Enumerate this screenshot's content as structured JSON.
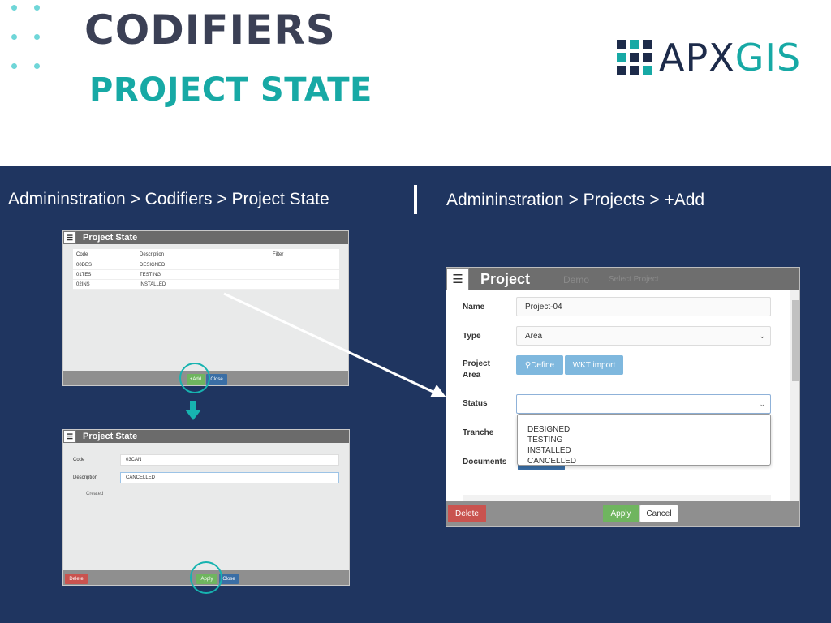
{
  "header": {
    "title": "CODIFIERS",
    "subtitle": "PROJECT STATE",
    "logo": {
      "part1": "APX",
      "part2": "GIS"
    },
    "logo_colors": [
      "#1d2b4a",
      "#17a9a5"
    ]
  },
  "breadcrumbs": {
    "left": "Admininstration  > Codifiers  > Project State",
    "right": "Admininstration  > Projects > +Add"
  },
  "list_panel": {
    "title": "Project State",
    "columns": [
      "Code",
      "Description",
      "Filter"
    ],
    "rows": [
      {
        "code": "00DES",
        "description": "DESIGNED"
      },
      {
        "code": "01TES",
        "description": "TESTING"
      },
      {
        "code": "02INS",
        "description": "INSTALLED"
      }
    ],
    "add_label": "+Add",
    "close_label": "Close"
  },
  "edit_panel": {
    "title": "Project State",
    "code_label": "Code",
    "code_value": "03CAN",
    "description_label": "Description",
    "description_value": "CANCELLED",
    "created_label": "Created",
    "created_value": "-",
    "delete_label": "Delete",
    "apply_label": "Apply",
    "close_label": "Close"
  },
  "project_form": {
    "title": "Project",
    "ghost_text": "Demo",
    "ghost_select": "Select Project",
    "name_label": "Name",
    "name_value": "Project-04",
    "type_label": "Type",
    "type_value": "Area",
    "area_label": "Project Area",
    "define_label": "Define",
    "wkt_label": "WKT import",
    "status_label": "Status",
    "status_value": "",
    "tranche_label": "Tranche",
    "documents_label": "Documents",
    "status_options": [
      "DESIGNED",
      "TESTING",
      "INSTALLED",
      "CANCELLED"
    ],
    "delete_label": "Delete",
    "apply_label": "Apply",
    "cancel_label": "Cancel"
  },
  "colors": {
    "navy": "#1f3560",
    "teal": "#17a9a5",
    "green": "#6fb55f",
    "blue": "#3a6ea5",
    "red": "#c9534f"
  }
}
